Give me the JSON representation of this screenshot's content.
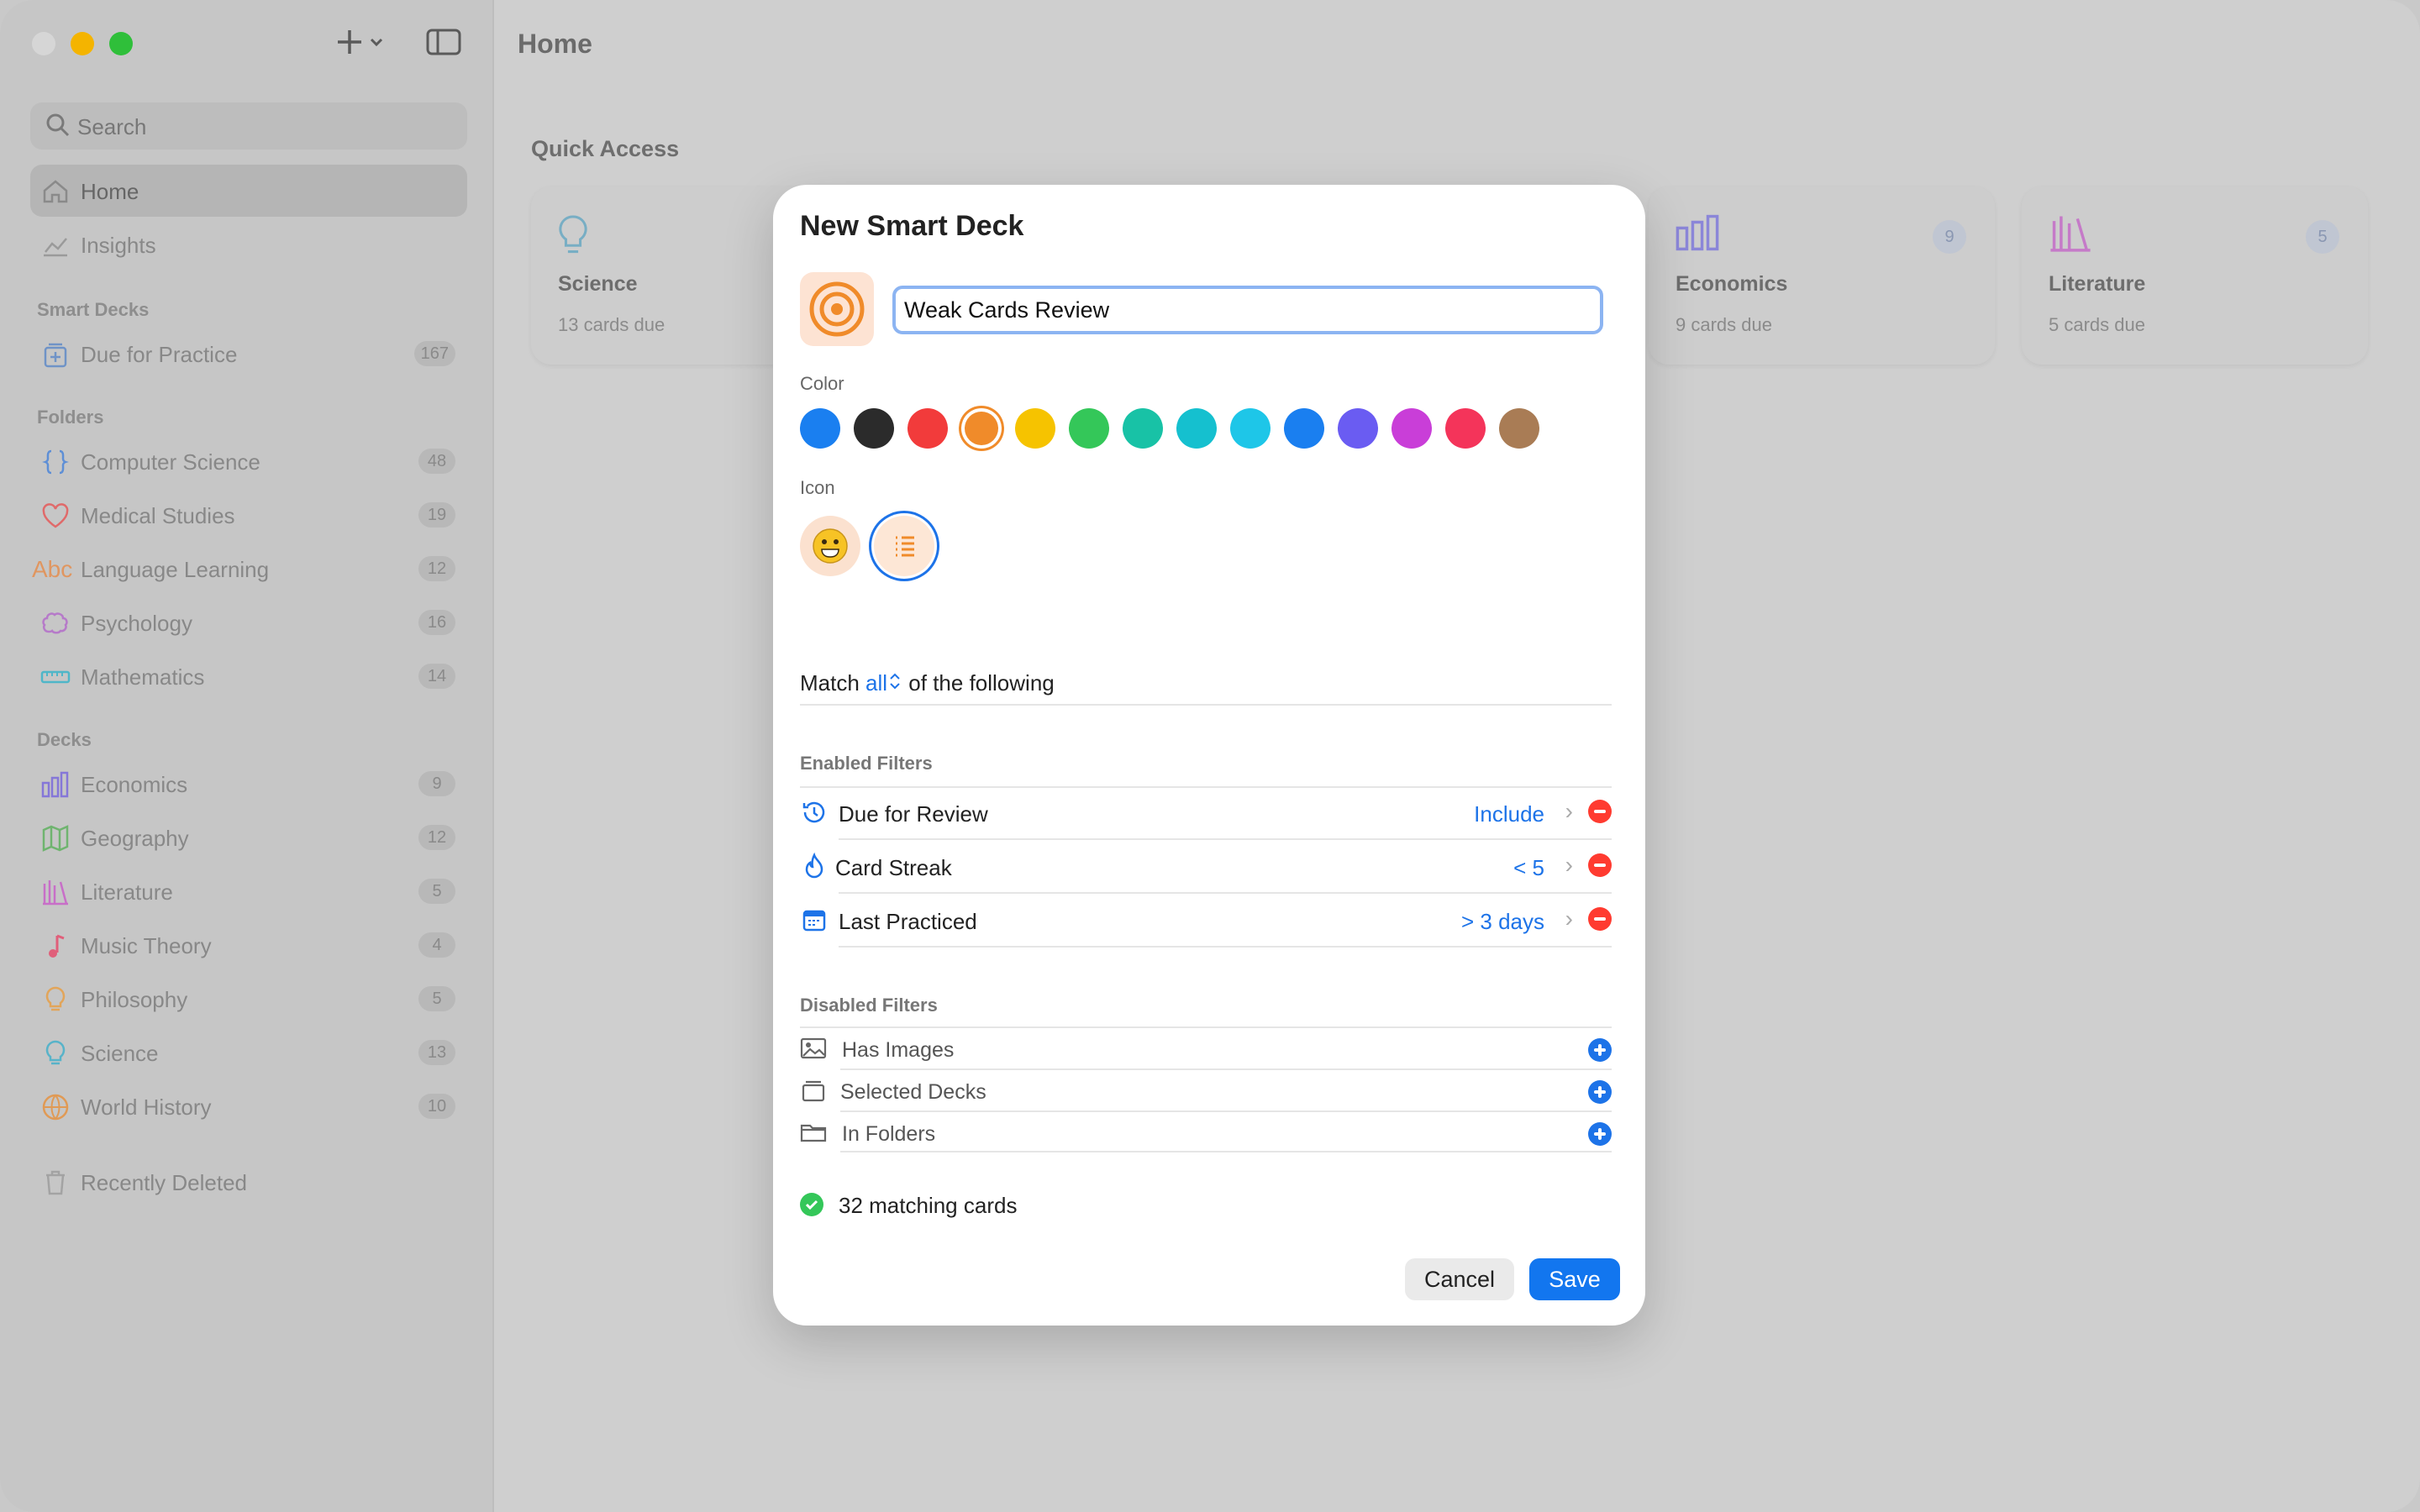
{
  "sidebar": {
    "search_placeholder": "Search",
    "nav": [
      {
        "label": "Home"
      },
      {
        "label": "Insights"
      }
    ],
    "smart_decks_title": "Smart Decks",
    "smart_decks": [
      {
        "label": "Due for Practice",
        "count": "167"
      }
    ],
    "folders_title": "Folders",
    "folders": [
      {
        "label": "Computer Science",
        "count": "48"
      },
      {
        "label": "Medical Studies",
        "count": "19"
      },
      {
        "label": "Language Learning",
        "count": "12"
      },
      {
        "label": "Psychology",
        "count": "16"
      },
      {
        "label": "Mathematics",
        "count": "14"
      }
    ],
    "decks_title": "Decks",
    "decks": [
      {
        "label": "Economics",
        "count": "9"
      },
      {
        "label": "Geography",
        "count": "12"
      },
      {
        "label": "Literature",
        "count": "5"
      },
      {
        "label": "Music Theory",
        "count": "4"
      },
      {
        "label": "Philosophy",
        "count": "5"
      },
      {
        "label": "Science",
        "count": "13"
      },
      {
        "label": "World History",
        "count": "10"
      }
    ],
    "recently_deleted": "Recently Deleted"
  },
  "main": {
    "title": "Home",
    "quick_access_title": "Quick Access",
    "cards": [
      {
        "name": "Science",
        "sub": "13 cards due"
      },
      {
        "name": "Economics",
        "sub": "9 cards due",
        "badge": "9"
      },
      {
        "name": "Literature",
        "sub": "5 cards due",
        "badge": "5"
      }
    ]
  },
  "modal": {
    "title": "New Smart Deck",
    "name_value": "Weak Cards Review",
    "color_label": "Color",
    "colors": [
      "#1a7ff0",
      "#2b2b2b",
      "#f23b3b",
      "#f08b2a",
      "#f6c300",
      "#34c759",
      "#18c2a6",
      "#15c0cf",
      "#1ec6e8",
      "#1a7ff0",
      "#6a5cf2",
      "#c93ed8",
      "#f4345a",
      "#a97c55"
    ],
    "selected_color": "#f08b2a",
    "icon_label": "Icon",
    "icon_choices": [
      "emoji-icon",
      "list-icon"
    ],
    "match_prefix": "Match",
    "match_mode": "all",
    "match_suffix": "of the following",
    "enabled_title": "Enabled Filters",
    "enabled": [
      {
        "name": "Due for Review",
        "value": "Include",
        "icon": "clock-icon"
      },
      {
        "name": "Card Streak",
        "value": "< 5",
        "icon": "flame-icon"
      },
      {
        "name": "Last Practiced",
        "value": "> 3 days",
        "icon": "calendar-icon"
      }
    ],
    "disabled_title": "Disabled Filters",
    "disabled": [
      {
        "name": "Has Images",
        "icon": "image-icon"
      },
      {
        "name": "Selected Decks",
        "icon": "deck-icon"
      },
      {
        "name": "In Folders",
        "icon": "folder-icon"
      }
    ],
    "status": "32 matching cards",
    "cancel_label": "Cancel",
    "save_label": "Save"
  }
}
